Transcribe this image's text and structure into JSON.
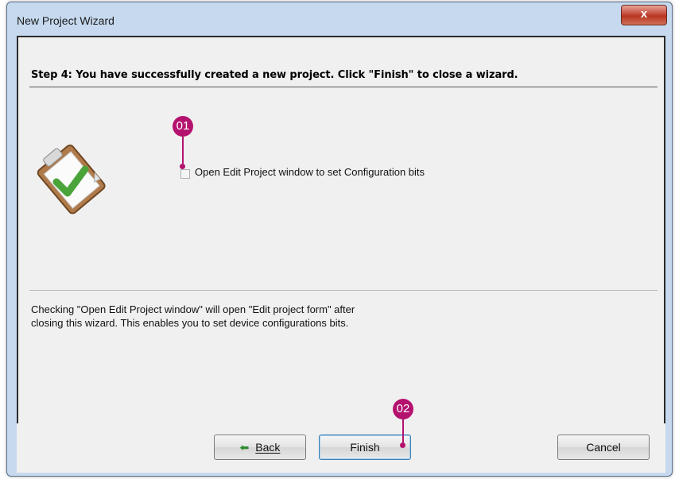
{
  "window": {
    "title": "New Project Wizard",
    "close_symbol": "x"
  },
  "step": {
    "title": "Step 4: You have successfully created a new project.  Click \"Finish\" to close a wizard."
  },
  "option": {
    "label": "Open Edit Project window to set Configuration bits",
    "checked": false
  },
  "info": {
    "line1": "Checking \"Open Edit Project window\" will open \"Edit project form\" after",
    "line2": "closing this wizard. This enables you to set device configurations bits."
  },
  "buttons": {
    "back_arrow": "⬅",
    "back_label": "Back",
    "finish_label": "Finish",
    "cancel_label": "Cancel"
  },
  "callouts": {
    "first": "01",
    "second": "02",
    "color": "#b4126f"
  },
  "icons": {
    "clipboard": "clipboard-check-icon",
    "back": "back-arrow-icon",
    "close": "close-icon"
  }
}
